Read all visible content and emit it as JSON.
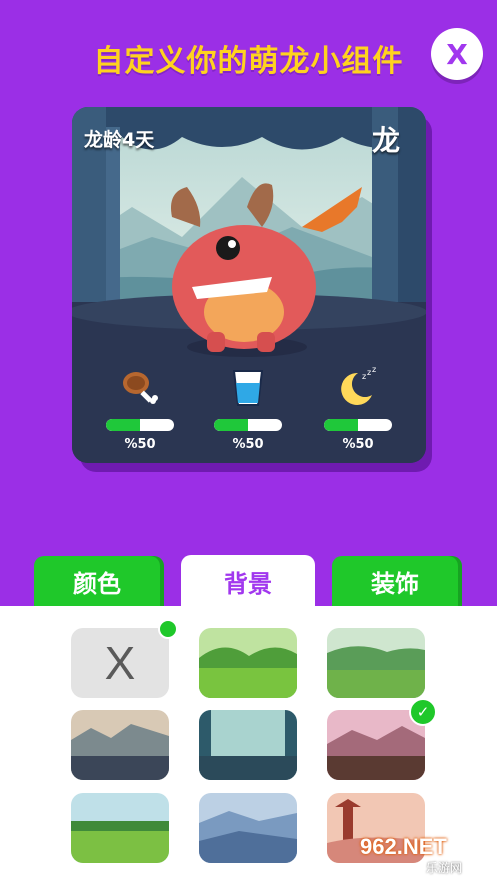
{
  "header": {
    "title": "自定义你的萌龙小组件",
    "close_label": "X"
  },
  "pet_card": {
    "age_label": "龙龄4天",
    "name": "龙",
    "stats": [
      {
        "icon": "meat-icon",
        "percent_label": "%50",
        "level": 0.5
      },
      {
        "icon": "water-glass-icon",
        "percent_label": "%50",
        "level": 0.5
      },
      {
        "icon": "moon-sleep-icon",
        "percent_label": "%50",
        "level": 0.5
      }
    ]
  },
  "tabs": [
    {
      "label": "颜色",
      "active": false
    },
    {
      "label": "背景",
      "active": true
    },
    {
      "label": "装饰",
      "active": false
    }
  ],
  "backgrounds": {
    "none_label": "X",
    "items": [
      {
        "name": "none",
        "selected_dot": true
      },
      {
        "name": "green-hills"
      },
      {
        "name": "green-meadow"
      },
      {
        "name": "rocky-valley"
      },
      {
        "name": "teal-forest"
      },
      {
        "name": "pink-castle",
        "selected": true
      },
      {
        "name": "hedge-field"
      },
      {
        "name": "blue-mountains"
      },
      {
        "name": "pagoda-sunset"
      }
    ]
  },
  "colors": {
    "background": "#9b2fe6",
    "title": "#ffd21f",
    "tab_green": "#1fc82a",
    "accent": "#a137ee"
  },
  "watermark": {
    "logo": "962.NET",
    "sub": "乐游网"
  }
}
